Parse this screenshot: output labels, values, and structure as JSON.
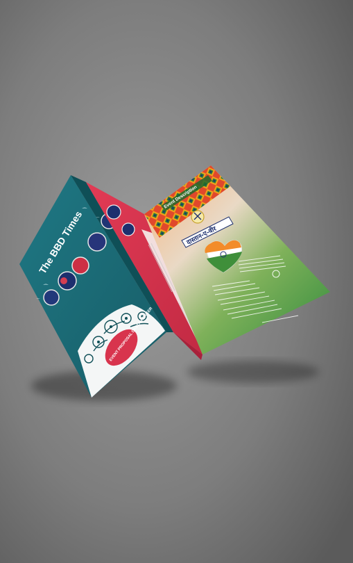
{
  "colors": {
    "background_light": "#9a9a9a",
    "background_dark": "#5e5e5e",
    "teal": "#1e6f79",
    "teal_dark": "#12535c",
    "crimson": "#d8344d",
    "navy": "#1d2f6e",
    "saffron": "#f28c2a",
    "green": "#3f8f3a"
  },
  "left_panel": {
    "title": "The BBD Times",
    "tagline": "",
    "badge_text": "EVENT PROPOSAL DASTAN-E-VEER"
  },
  "right_panel": {
    "header": "Event Description",
    "heading_devanagari": "दास्तान-ए-वीर"
  }
}
